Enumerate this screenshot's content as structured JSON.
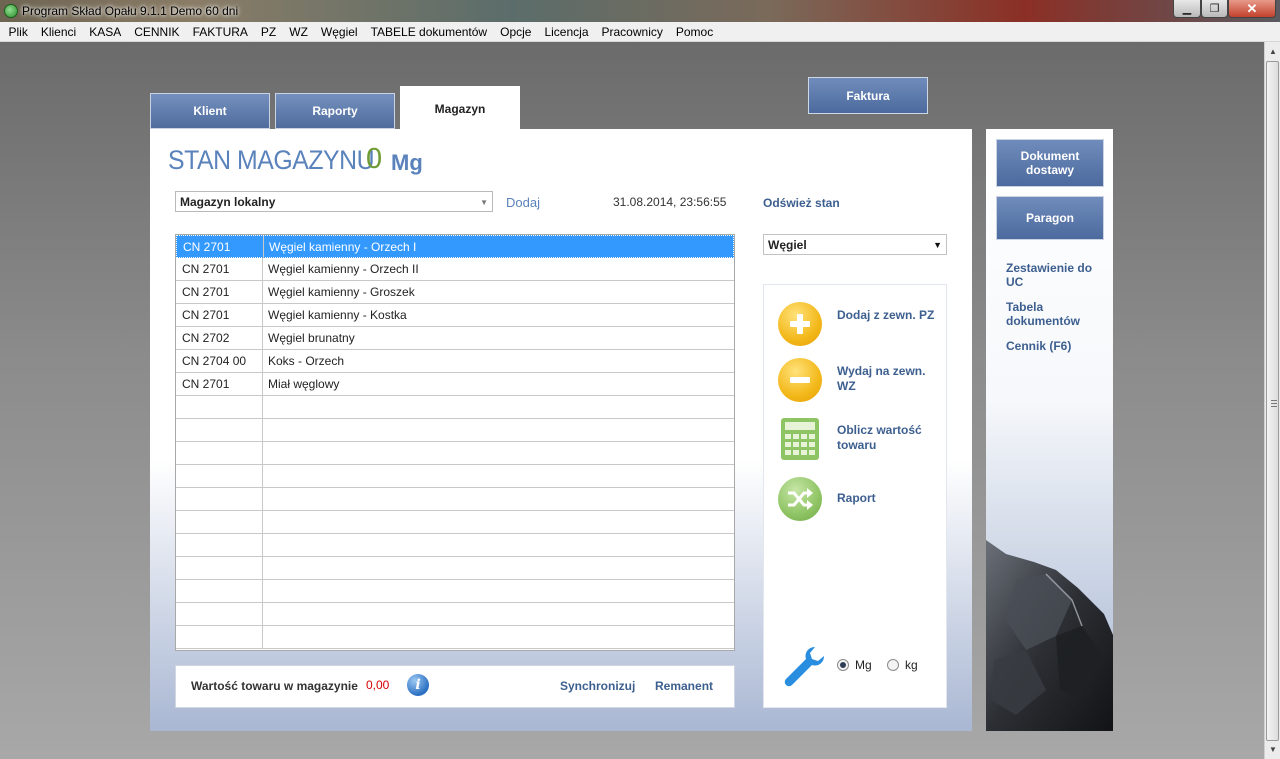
{
  "window": {
    "title": "Program Skład Opału 9.1.1    Demo 60 dni",
    "min_glyph": "▁",
    "max_glyph": "❐",
    "close_glyph": "✕"
  },
  "menu": [
    "Plik",
    "Klienci",
    "KASA",
    "CENNIK",
    "FAKTURA",
    "PZ",
    "WZ",
    "Węgiel",
    "TABELE dokumentów",
    "Opcje",
    "Licencja",
    "Pracownicy",
    "Pomoc"
  ],
  "tabs": {
    "klient": "Klient",
    "raporty": "Raporty",
    "magazyn": "Magazyn",
    "active": "Magazyn"
  },
  "faktura_button": "Faktura",
  "header": {
    "title": "STAN MAGAZYNU",
    "value": "0",
    "unit": "Mg"
  },
  "toolbar": {
    "warehouse_selected": "Magazyn lokalny",
    "add_link": "Dodaj",
    "timestamp": "31.08.2014, 23:56:55",
    "refresh_link": "Odśwież stan"
  },
  "table": {
    "rows": [
      {
        "code": "CN 2701",
        "name": "Węgiel kamienny - Orzech I",
        "selected": true
      },
      {
        "code": "CN 2701",
        "name": "Węgiel kamienny - Orzech II",
        "selected": false
      },
      {
        "code": "CN 2701",
        "name": "Węgiel kamienny - Groszek",
        "selected": false
      },
      {
        "code": "CN 2701",
        "name": "Węgiel kamienny - Kostka",
        "selected": false
      },
      {
        "code": "CN 2702",
        "name": "Węgiel brunatny",
        "selected": false
      },
      {
        "code": "CN 2704 00",
        "name": "Koks - Orzech",
        "selected": false
      },
      {
        "code": "CN 2701",
        "name": "Miał węglowy",
        "selected": false
      }
    ],
    "empty_rows": 11
  },
  "summary": {
    "label": "Wartość towaru w magazynie",
    "value": "0,00",
    "info_glyph": "i",
    "sync_link": "Synchronizuj",
    "remanent_link": "Remanent"
  },
  "category_select": {
    "selected": "Węgiel",
    "arrow": "▼"
  },
  "actions": [
    {
      "label": "Dodaj z zewn. PZ",
      "icon": "plus-circle-icon"
    },
    {
      "label": "Wydaj na zewn. WZ",
      "icon": "minus-circle-icon"
    },
    {
      "label": "Oblicz wartość towaru",
      "icon": "calculator-icon"
    },
    {
      "label": "Raport",
      "icon": "shuffle-icon"
    }
  ],
  "units": {
    "mg": "Mg",
    "kg": "kg",
    "selected": "Mg"
  },
  "sidebar": {
    "dokument_button": "Dokument dostawy",
    "paragon_button": "Paragon",
    "links": [
      "Zestawienie do UC",
      "Tabela dokumentów",
      "Cennik (F6)"
    ]
  },
  "colors": {
    "accent_blue": "#4f6c9e",
    "link_blue": "#3d5f8f",
    "title_blue": "#5a82bb",
    "value_green": "#6f9b36",
    "value_red": "#d40000",
    "selection_blue": "#3399ff"
  }
}
